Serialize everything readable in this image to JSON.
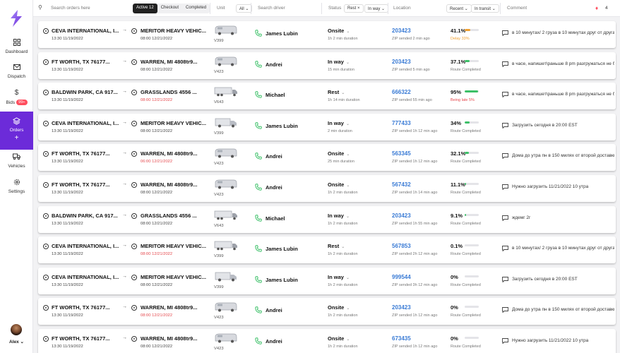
{
  "sidebar": {
    "items": [
      {
        "key": "dashboard",
        "label": "Dashboard",
        "icon": "grid-icon"
      },
      {
        "key": "dispatch",
        "label": "Dispatch",
        "icon": "mail-icon"
      },
      {
        "key": "bids",
        "label": "Bids",
        "icon": "dollar-icon",
        "badge": "99+"
      },
      {
        "key": "orders",
        "label": "Orders",
        "icon": "layers-icon",
        "active": true,
        "extra": "+"
      },
      {
        "key": "vehicles",
        "label": "Vehicles",
        "icon": "vehicles-icon"
      },
      {
        "key": "settings",
        "label": "Settings",
        "icon": "gear-icon"
      }
    ],
    "user": {
      "name": "Alex"
    }
  },
  "header": {
    "search_placeholder": "Search orders here",
    "tabs": [
      {
        "label": "Active 12",
        "active": true
      },
      {
        "label": "Checkout"
      },
      {
        "label": "Completed"
      }
    ],
    "unit_label": "Unit",
    "unit_filter": "All",
    "driver_placeholder": "Search driver",
    "status_label": "Status",
    "status_filter": "Rest",
    "status_filter2": "In way",
    "location_label": "Location",
    "sort_filter": "Recent",
    "transit_filter": "In transit",
    "comment_label": "Comment",
    "notifications": "4"
  },
  "colors": {
    "accent": "#6c2bd9",
    "link": "#3a7bd5",
    "progress_orange": "#f0a030",
    "progress_green": "#3cc068",
    "danger": "#e5484d"
  },
  "orders": [
    {
      "from": "CEVA INTERNATIONAL, I...",
      "from_time": "13:30 11/19/2022",
      "to": "MERITOR HEAVY VEHIC...",
      "to_time": "08:00 12/21/2022",
      "to_late": false,
      "truck": "van",
      "vehicle": "V399",
      "driver": "James Lubin",
      "status": "Onsite",
      "duration": "1h 2 min duration",
      "zip": "203423",
      "zip_note": "ZIP sended 2 min ago",
      "progress": "41.1%",
      "progress_value": 41.1,
      "progress_color": "orange",
      "route_status": "Delay 33%",
      "route_tone": "orange",
      "comment": "в 10 минутах/ 2 груза в 10 минутах друг от друга"
    },
    {
      "from": "FT WORTH, TX 76177...",
      "from_time": "13:30 11/19/2022",
      "to": "WARREN, MI 4808tr9...",
      "to_time": "08:00 12/21/2022",
      "to_late": false,
      "truck": "van",
      "vehicle": "V423",
      "driver": "Andrei",
      "status": "In way",
      "duration": "15 min duration",
      "zip": "203423",
      "zip_note": "ZIP sended 5 min ago",
      "progress": "37.1%",
      "progress_value": 37.1,
      "progress_color": "green",
      "route_status": "Route Completed",
      "route_tone": "",
      "comment": "в часе, напишет\\раньше 8 pm разгружаться не будет"
    },
    {
      "from": "BALDWIN PARK, CA 917...",
      "from_time": "13:30 11/19/2022",
      "to": "GRASSLANDS 4556 ...",
      "to_time": "08:00 12/21/2022",
      "to_late": true,
      "truck": "semi",
      "vehicle": "V643",
      "driver": "Michael",
      "status": "Rest",
      "duration": "1h 14 min duration",
      "zip": "666322",
      "zip_note": "ZIP sended 55 min ago",
      "progress": "95%",
      "progress_value": 95,
      "progress_color": "green",
      "route_status": "Being late 5%",
      "route_tone": "red",
      "comment": "в часе, напишет\\раньше 8 pm разгружаться не будет"
    },
    {
      "from": "CEVA INTERNATIONAL, I...",
      "from_time": "13:30 11/19/2022",
      "to": "MERITOR HEAVY VEHIC...",
      "to_time": "08:00 12/21/2022",
      "to_late": false,
      "truck": "box",
      "vehicle": "V399",
      "driver": "James Lubin",
      "status": "In way",
      "duration": "2 min duration",
      "zip": "777433",
      "zip_note": "ZIP sended 1h 12 min ago",
      "progress": "34%",
      "progress_value": 34,
      "progress_color": "green",
      "route_status": "Route Completed",
      "route_tone": "",
      "comment": "Загрузить сегодня в 20:00 EST"
    },
    {
      "from": "FT WORTH, TX 76177...",
      "from_time": "13:30 11/19/2022",
      "to": "WARREN, MI 4808tr9...",
      "to_time": "06:00 12/21/2022",
      "to_late": true,
      "truck": "van",
      "vehicle": "V423",
      "driver": "Andrei",
      "status": "Onsite",
      "duration": "25 min duration",
      "zip": "563345",
      "zip_note": "ZIP sended 1h 12 min ago",
      "progress": "32.1%",
      "progress_value": 32.1,
      "progress_color": "green",
      "route_status": "Route Completed",
      "route_tone": "",
      "comment": "Дома до утра пн в 150 милях от второй доставки"
    },
    {
      "from": "FT WORTH, TX 76177...",
      "from_time": "13:30 11/19/2022",
      "to": "WARREN, MI 4808tr9...",
      "to_time": "08:00 12/21/2022",
      "to_late": false,
      "truck": "van",
      "vehicle": "V423",
      "driver": "Andrei",
      "status": "Onsite",
      "duration": "1h 2 min duration",
      "zip": "567432",
      "zip_note": "ZIP sended 1h 14 min ago",
      "progress": "11.1%",
      "progress_value": 11.1,
      "progress_color": "green",
      "route_status": "Route Completed",
      "route_tone": "",
      "comment": "Нужно загрузить 11/21/2022 10 утра"
    },
    {
      "from": "BALDWIN PARK, CA 917...",
      "from_time": "13:30 11/19/2022",
      "to": "GRASSLANDS 4556 ...",
      "to_time": "08:00 12/21/2022",
      "to_late": false,
      "truck": "semi",
      "vehicle": "V643",
      "driver": "Michael",
      "status": "In way",
      "duration": "1h 2 min duration",
      "zip": "203423",
      "zip_note": "ZIP sended 1h 55 min ago",
      "progress": "9.1%",
      "progress_value": 9.1,
      "progress_color": "green",
      "route_status": "Route Completed",
      "route_tone": "",
      "comment": "ждемг 2г"
    },
    {
      "from": "CEVA INTERNATIONAL, I...",
      "from_time": "13:30 11/19/2022",
      "to": "MERITOR HEAVY VEHIC...",
      "to_time": "08:00 12/21/2022",
      "to_late": true,
      "truck": "semi",
      "vehicle": "V399",
      "driver": "James Lubin",
      "status": "Rest",
      "duration": "1h 2 min duration",
      "zip": "567853",
      "zip_note": "ZIP sended 2h 12 min ago",
      "progress": "0.1%",
      "progress_value": 0.1,
      "progress_color": "green",
      "route_status": "Route Completed",
      "route_tone": "",
      "comment": "в 10 минутах/ 2 груза в 10 минутах друг от друга"
    },
    {
      "from": "CEVA INTERNATIONAL, I...",
      "from_time": "13:30 11/19/2022",
      "to": "MERITOR HEAVY VEHIC...",
      "to_time": "08:00 12/21/2022",
      "to_late": false,
      "truck": "box",
      "vehicle": "V399",
      "driver": "James Lubin",
      "status": "In way",
      "duration": "1h 2 min duration",
      "zip": "999544",
      "zip_note": "ZIP sended 3h 12 min ago",
      "progress": "0%",
      "progress_value": 0,
      "progress_color": "green",
      "route_status": "Route Completed",
      "route_tone": "",
      "comment": "Загрузить сегодня в 20:00 EST"
    },
    {
      "from": "FT WORTH, TX 76177...",
      "from_time": "13:30 11/19/2022",
      "to": "WARREN, MI 4808tr9...",
      "to_time": "08:00 12/21/2022",
      "to_late": true,
      "truck": "van",
      "vehicle": "V423",
      "driver": "Andrei",
      "status": "Onsite",
      "duration": "1h 2 min duration",
      "zip": "203423",
      "zip_note": "ZIP sended 1h 12 min ago",
      "progress": "0%",
      "progress_value": 0,
      "progress_color": "green",
      "route_status": "Route Completed",
      "route_tone": "",
      "comment": "Дома до утра пн в 150 милях от второй доставки"
    },
    {
      "from": "FT WORTH, TX 76177...",
      "from_time": "13:30 11/19/2022",
      "to": "WARREN, MI 4808tr9...",
      "to_time": "08:00 12/21/2022",
      "to_late": false,
      "truck": "van",
      "vehicle": "V423",
      "driver": "Andrei",
      "status": "Onsite",
      "duration": "1h 2 min duration",
      "zip": "673435",
      "zip_note": "ZIP sended 1h 12 min ago",
      "progress": "0%",
      "progress_value": 0,
      "progress_color": "green",
      "route_status": "Route Completed",
      "route_tone": "",
      "comment": "Нужно загрузить 11/21/2022 10 утра"
    }
  ]
}
